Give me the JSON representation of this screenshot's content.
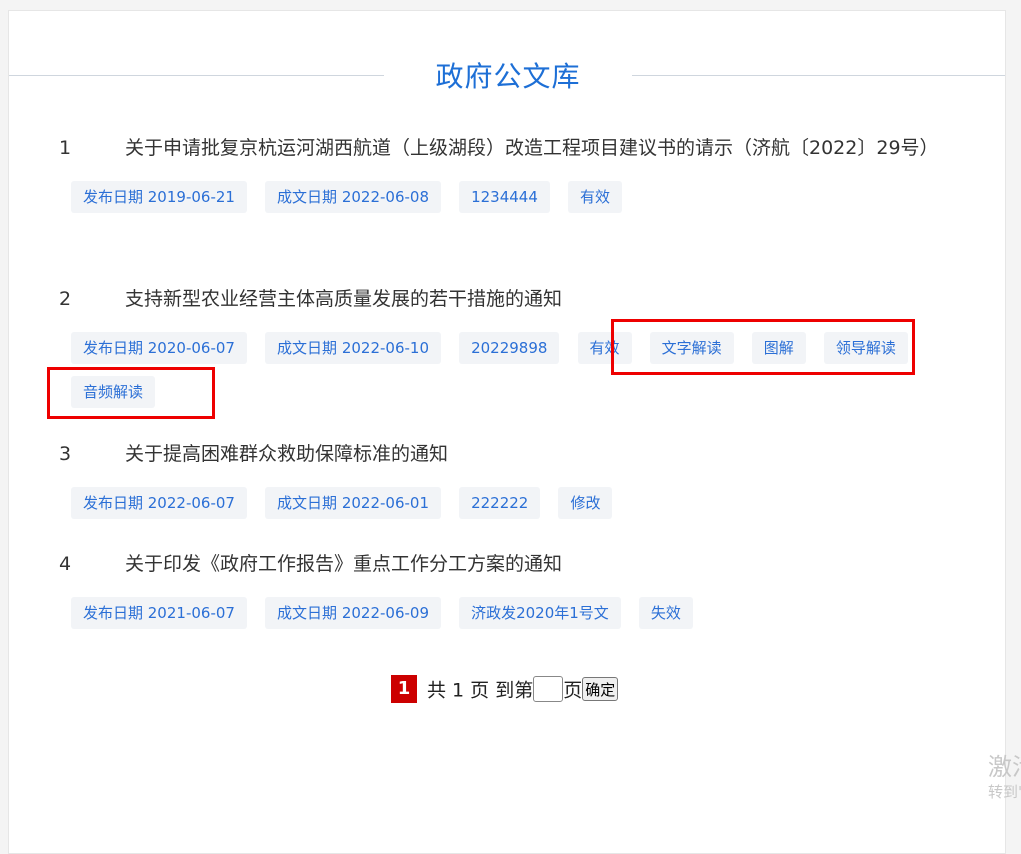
{
  "page": {
    "title": "政府公文库"
  },
  "documents": [
    {
      "num": "1",
      "title": "关于申请批复京杭运河湖西航道（上级湖段）改造工程项目建议书的请示（济航〔2022〕29号）",
      "tags": [
        "发布日期 2019-06-21",
        "成文日期 2022-06-08",
        "1234444",
        "有效"
      ]
    },
    {
      "num": "2",
      "title": "支持新型农业经营主体高质量发展的若干措施的通知",
      "tags": [
        "发布日期 2020-06-07",
        "成文日期 2022-06-10",
        "20229898",
        "有效",
        "文字解读",
        "图解",
        "领导解读",
        "音频解读"
      ]
    },
    {
      "num": "3",
      "title": "关于提高困难群众救助保障标准的通知",
      "tags": [
        "发布日期 2022-06-07",
        "成文日期 2022-06-01",
        "222222",
        "修改"
      ]
    },
    {
      "num": "4",
      "title": "关于印发《政府工作报告》重点工作分工方案的通知",
      "tags": [
        "发布日期 2021-06-07",
        "成文日期 2022-06-09",
        "济政发2020年1号文",
        "失效"
      ]
    }
  ],
  "pager": {
    "current": "1",
    "total_text": "共 1 页",
    "goto_prefix": "到第",
    "goto_suffix": "页",
    "page_input_value": "",
    "confirm_label": "确定"
  },
  "watermark": {
    "line1": "激活 Windows",
    "line2": "转到\"设置\"以激活 Windows。"
  },
  "colors": {
    "title": "#1d6fd6",
    "tag_text": "#2b6fd6",
    "tag_bg": "#f2f4f7",
    "highlight": "#ee0000",
    "pager_current": "#cc0000"
  }
}
